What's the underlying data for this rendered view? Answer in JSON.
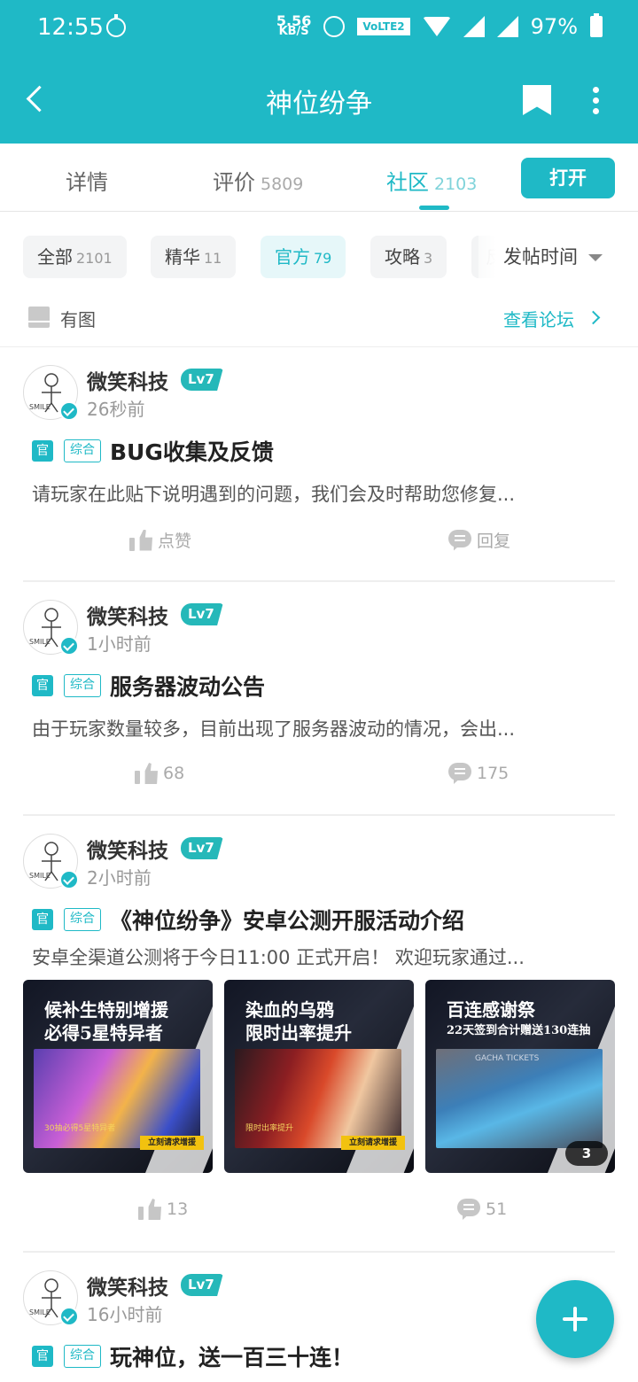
{
  "status_bar": {
    "time": "12:55",
    "speed_value": "5.56",
    "speed_unit": "KB/S",
    "volte": "VoLTE2",
    "battery": "97%"
  },
  "app_bar": {
    "title": "神位纷争"
  },
  "tabs": [
    {
      "label": "详情",
      "count": ""
    },
    {
      "label": "评价",
      "count": "5809"
    },
    {
      "label": "社区",
      "count": "2103"
    }
  ],
  "open_button": "打开",
  "filter_chips": [
    {
      "label": "全部",
      "count": "2101"
    },
    {
      "label": "精华",
      "count": "11"
    },
    {
      "label": "官方",
      "count": "79"
    },
    {
      "label": "攻略",
      "count": "3"
    },
    {
      "label": "反",
      "count": ""
    }
  ],
  "sort_label": "发帖时间",
  "has_image_label": "有图",
  "view_forum": "查看论坛",
  "posts": [
    {
      "author": "微笑科技",
      "level": "Lv7",
      "time": "26秒前",
      "official_tag": "官",
      "category_tag": "综合",
      "title": "BUG收集及反馈",
      "excerpt": "请玩家在此贴下说明遇到的问题，我们会及时帮助您修复...",
      "likes": "点赞",
      "replies": "回复"
    },
    {
      "author": "微笑科技",
      "level": "Lv7",
      "time": "1小时前",
      "official_tag": "官",
      "category_tag": "综合",
      "title": "服务器波动公告",
      "excerpt": "由于玩家数量较多，目前出现了服务器波动的情况，会出...",
      "likes": "68",
      "replies": "175"
    },
    {
      "author": "微笑科技",
      "level": "Lv7",
      "time": "2小时前",
      "official_tag": "官",
      "category_tag": "综合",
      "title": "《神位纷争》安卓公测开服活动介绍",
      "excerpt": "安卓全渠道公测将于今日11:00 正式开启！ 欢迎玩家通过...",
      "images": [
        {
          "line1": "候补生特别增援",
          "line2": "必得5星特异者",
          "cta": "立刻请求增援",
          "note": "30抽必得5星特异者"
        },
        {
          "line1": "染血的乌鸦",
          "line2": "限时出率提升",
          "cta": "立刻请求增援",
          "note": "限时出率提升"
        },
        {
          "line1": "百连感谢祭",
          "line2": "22天签到合计赠送130连抽",
          "cta": "",
          "note": "GACHA TICKETS"
        }
      ],
      "image_more_count": "3",
      "likes": "13",
      "replies": "51"
    },
    {
      "author": "微笑科技",
      "level": "Lv7",
      "time": "16小时前",
      "official_tag": "官",
      "category_tag": "综合",
      "title": "玩神位，送一百三十连！"
    }
  ],
  "colors": {
    "accent": "#1fb9c6",
    "level_badge": "#25b8b9"
  }
}
